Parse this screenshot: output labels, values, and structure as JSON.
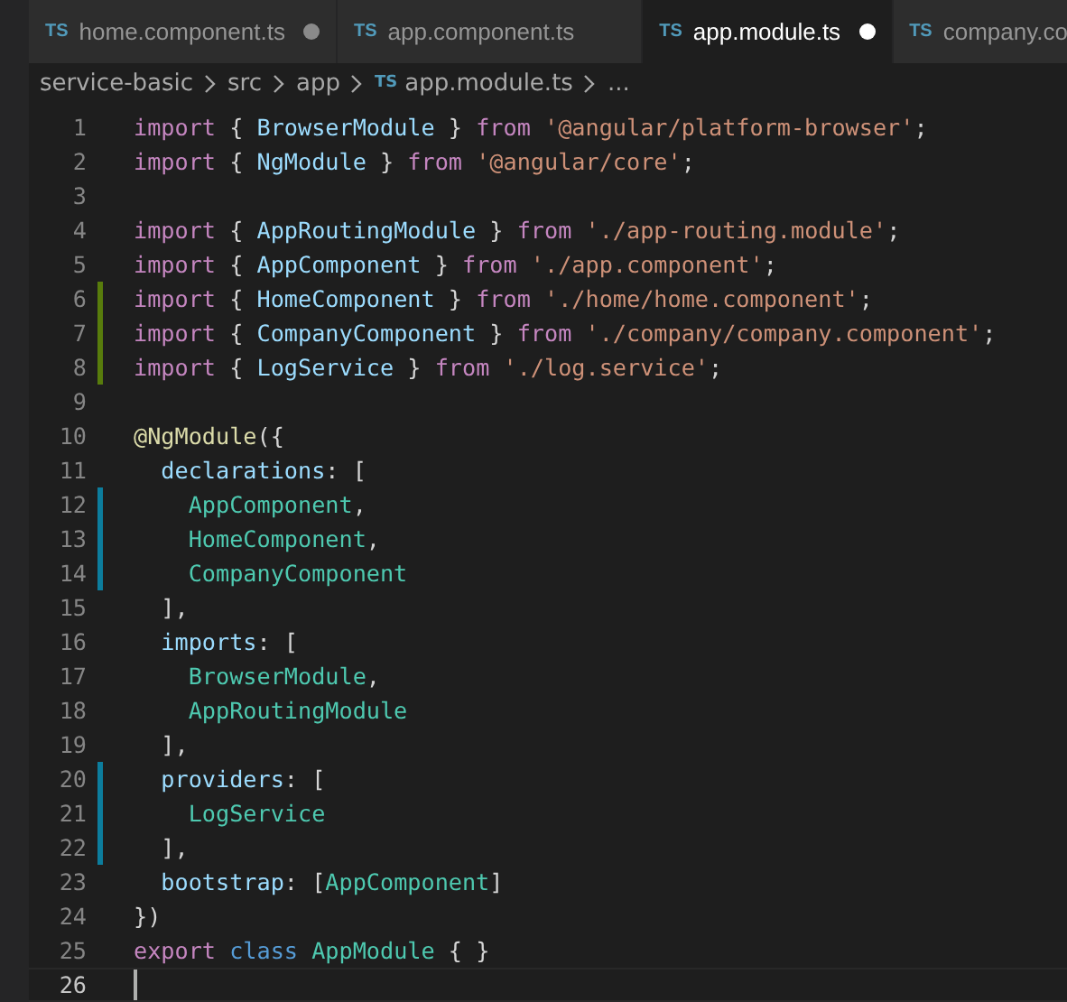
{
  "tabs": [
    {
      "icon": "TS",
      "label": "home.component.ts",
      "modified": true,
      "selected": false
    },
    {
      "icon": "TS",
      "label": "app.component.ts",
      "modified": false,
      "selected": false
    },
    {
      "icon": "TS",
      "label": "app.module.ts",
      "modified": true,
      "selected": true
    },
    {
      "icon": "TS",
      "label": "company.co",
      "modified": false,
      "selected": false
    }
  ],
  "breadcrumbs": [
    {
      "label": "service-basic"
    },
    {
      "label": "src"
    },
    {
      "label": "app"
    },
    {
      "icon": "TS",
      "label": "app.module.ts"
    },
    {
      "label": "..."
    }
  ],
  "lines": [
    {
      "number": "1",
      "added": false,
      "modified": false,
      "current": false,
      "tokens": [
        {
          "kind": "kw",
          "text": "import"
        },
        {
          "kind": "plain",
          "text": " { "
        },
        {
          "kind": "var",
          "text": "BrowserModule"
        },
        {
          "kind": "plain",
          "text": " } "
        },
        {
          "kind": "kw",
          "text": "from "
        },
        {
          "kind": "str",
          "text": "'@angular/platform-browser'"
        },
        {
          "kind": "plain",
          "text": ";"
        }
      ]
    },
    {
      "number": "2",
      "added": false,
      "modified": false,
      "current": false,
      "tokens": [
        {
          "kind": "kw",
          "text": "import"
        },
        {
          "kind": "plain",
          "text": " { "
        },
        {
          "kind": "var",
          "text": "NgModule"
        },
        {
          "kind": "plain",
          "text": " } "
        },
        {
          "kind": "kw",
          "text": "from "
        },
        {
          "kind": "str",
          "text": "'@angular/core'"
        },
        {
          "kind": "plain",
          "text": ";"
        }
      ]
    },
    {
      "number": "3",
      "added": false,
      "modified": false,
      "current": false
    },
    {
      "number": "4",
      "added": false,
      "modified": false,
      "current": false,
      "tokens": [
        {
          "kind": "kw",
          "text": "import"
        },
        {
          "kind": "plain",
          "text": " { "
        },
        {
          "kind": "var",
          "text": "AppRoutingModule"
        },
        {
          "kind": "plain",
          "text": " } "
        },
        {
          "kind": "kw",
          "text": "from "
        },
        {
          "kind": "str",
          "text": "'./app-routing.module'"
        },
        {
          "kind": "plain",
          "text": ";"
        }
      ]
    },
    {
      "number": "5",
      "added": false,
      "modified": false,
      "current": false,
      "tokens": [
        {
          "kind": "kw",
          "text": "import"
        },
        {
          "kind": "plain",
          "text": " { "
        },
        {
          "kind": "var",
          "text": "AppComponent"
        },
        {
          "kind": "plain",
          "text": " } "
        },
        {
          "kind": "kw",
          "text": "from "
        },
        {
          "kind": "str",
          "text": "'./app.component'"
        },
        {
          "kind": "plain",
          "text": ";"
        }
      ]
    },
    {
      "number": "6",
      "added": true,
      "modified": false,
      "current": false,
      "tokens": [
        {
          "kind": "kw",
          "text": "import"
        },
        {
          "kind": "plain",
          "text": " { "
        },
        {
          "kind": "var",
          "text": "HomeComponent"
        },
        {
          "kind": "plain",
          "text": " } "
        },
        {
          "kind": "kw",
          "text": "from "
        },
        {
          "kind": "str",
          "text": "'./home/home.component'"
        },
        {
          "kind": "plain",
          "text": ";"
        }
      ]
    },
    {
      "number": "7",
      "added": true,
      "modified": false,
      "current": false,
      "tokens": [
        {
          "kind": "kw",
          "text": "import"
        },
        {
          "kind": "plain",
          "text": " { "
        },
        {
          "kind": "var",
          "text": "CompanyComponent"
        },
        {
          "kind": "plain",
          "text": " } "
        },
        {
          "kind": "kw",
          "text": "from "
        },
        {
          "kind": "str",
          "text": "'./company/company.component'"
        },
        {
          "kind": "plain",
          "text": ";"
        }
      ]
    },
    {
      "number": "8",
      "added": true,
      "modified": false,
      "current": false,
      "tokens": [
        {
          "kind": "kw",
          "text": "import"
        },
        {
          "kind": "plain",
          "text": " { "
        },
        {
          "kind": "var",
          "text": "LogService"
        },
        {
          "kind": "plain",
          "text": " } "
        },
        {
          "kind": "kw",
          "text": "from "
        },
        {
          "kind": "str",
          "text": "'./log.service'"
        },
        {
          "kind": "plain",
          "text": ";"
        }
      ]
    },
    {
      "number": "9",
      "added": false,
      "modified": false,
      "current": false
    },
    {
      "number": "10",
      "added": false,
      "modified": false,
      "current": false,
      "tokens": [
        {
          "kind": "fn",
          "text": "@NgModule"
        },
        {
          "kind": "plain",
          "text": "({"
        }
      ]
    },
    {
      "number": "11",
      "added": false,
      "modified": false,
      "current": false,
      "tokens": [
        {
          "kind": "var",
          "text": "  declarations"
        },
        {
          "kind": "plain",
          "text": ": ["
        }
      ]
    },
    {
      "number": "12",
      "added": false,
      "modified": true,
      "current": false,
      "tokens": [
        {
          "kind": "type",
          "text": "    AppComponent"
        },
        {
          "kind": "plain",
          "text": ","
        }
      ]
    },
    {
      "number": "13",
      "added": false,
      "modified": true,
      "current": false,
      "tokens": [
        {
          "kind": "type",
          "text": "    HomeComponent"
        },
        {
          "kind": "plain",
          "text": ","
        }
      ]
    },
    {
      "number": "14",
      "added": false,
      "modified": true,
      "current": false,
      "tokens": [
        {
          "kind": "type",
          "text": "    CompanyComponent"
        }
      ]
    },
    {
      "number": "15",
      "added": false,
      "modified": false,
      "current": false,
      "tokens": [
        {
          "kind": "plain",
          "text": "  ],"
        }
      ]
    },
    {
      "number": "16",
      "added": false,
      "modified": false,
      "current": false,
      "tokens": [
        {
          "kind": "var",
          "text": "  imports"
        },
        {
          "kind": "plain",
          "text": ": ["
        }
      ]
    },
    {
      "number": "17",
      "added": false,
      "modified": false,
      "current": false,
      "tokens": [
        {
          "kind": "type",
          "text": "    BrowserModule"
        },
        {
          "kind": "plain",
          "text": ","
        }
      ]
    },
    {
      "number": "18",
      "added": false,
      "modified": false,
      "current": false,
      "tokens": [
        {
          "kind": "type",
          "text": "    AppRoutingModule"
        }
      ]
    },
    {
      "number": "19",
      "added": false,
      "modified": false,
      "current": false,
      "tokens": [
        {
          "kind": "plain",
          "text": "  ],"
        }
      ]
    },
    {
      "number": "20",
      "added": false,
      "modified": true,
      "current": false,
      "tokens": [
        {
          "kind": "var",
          "text": "  providers"
        },
        {
          "kind": "plain",
          "text": ": ["
        }
      ]
    },
    {
      "number": "21",
      "added": false,
      "modified": true,
      "current": false,
      "tokens": [
        {
          "kind": "type",
          "text": "    LogService"
        }
      ]
    },
    {
      "number": "22",
      "added": false,
      "modified": true,
      "current": false,
      "tokens": [
        {
          "kind": "plain",
          "text": "  ],"
        }
      ]
    },
    {
      "number": "23",
      "added": false,
      "modified": false,
      "current": false,
      "tokens": [
        {
          "kind": "var",
          "text": "  bootstrap"
        },
        {
          "kind": "plain",
          "text": ": ["
        },
        {
          "kind": "type",
          "text": "AppComponent"
        },
        {
          "kind": "plain",
          "text": "]"
        }
      ]
    },
    {
      "number": "24",
      "added": false,
      "modified": false,
      "current": false,
      "tokens": [
        {
          "kind": "plain",
          "text": "})"
        }
      ]
    },
    {
      "number": "25",
      "added": false,
      "modified": false,
      "current": false,
      "tokens": [
        {
          "kind": "kw",
          "text": "export "
        },
        {
          "kind": "storage",
          "text": "class "
        },
        {
          "kind": "type",
          "text": "AppModule"
        },
        {
          "kind": "plain",
          "text": " { }"
        }
      ]
    },
    {
      "number": "26",
      "added": false,
      "modified": false,
      "current": true
    }
  ]
}
